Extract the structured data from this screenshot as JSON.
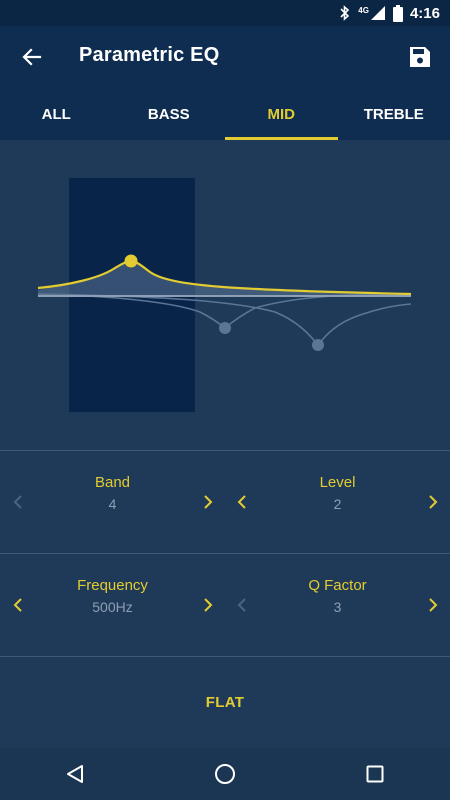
{
  "status_bar": {
    "time": "4:16",
    "network": "4G",
    "icons": [
      "bluetooth-icon",
      "signal-icon",
      "battery-icon"
    ]
  },
  "app_bar": {
    "title": "Parametric EQ",
    "back_icon": "arrow-left-icon",
    "save_icon": "floppy-disk-icon"
  },
  "tabs": [
    {
      "label": "ALL",
      "active": false
    },
    {
      "label": "BASS",
      "active": false
    },
    {
      "label": "MID",
      "active": true
    },
    {
      "label": "TREBLE",
      "active": false
    }
  ],
  "controls": {
    "band": {
      "label": "Band",
      "value": "4"
    },
    "level": {
      "label": "Level",
      "value": "2"
    },
    "frequency": {
      "label": "Frequency",
      "value": "500Hz"
    },
    "q_factor": {
      "label": "Q Factor",
      "value": "3"
    }
  },
  "flat_button": {
    "label": "FLAT"
  },
  "colors": {
    "accent": "#e3cc31",
    "background": "#1f3a58",
    "header": "#0f2d50",
    "status_bar": "#0b2545",
    "selected_band_region": "#082449",
    "inactive_curve": "#5b7595",
    "muted_text": "#8d9fb4"
  }
}
